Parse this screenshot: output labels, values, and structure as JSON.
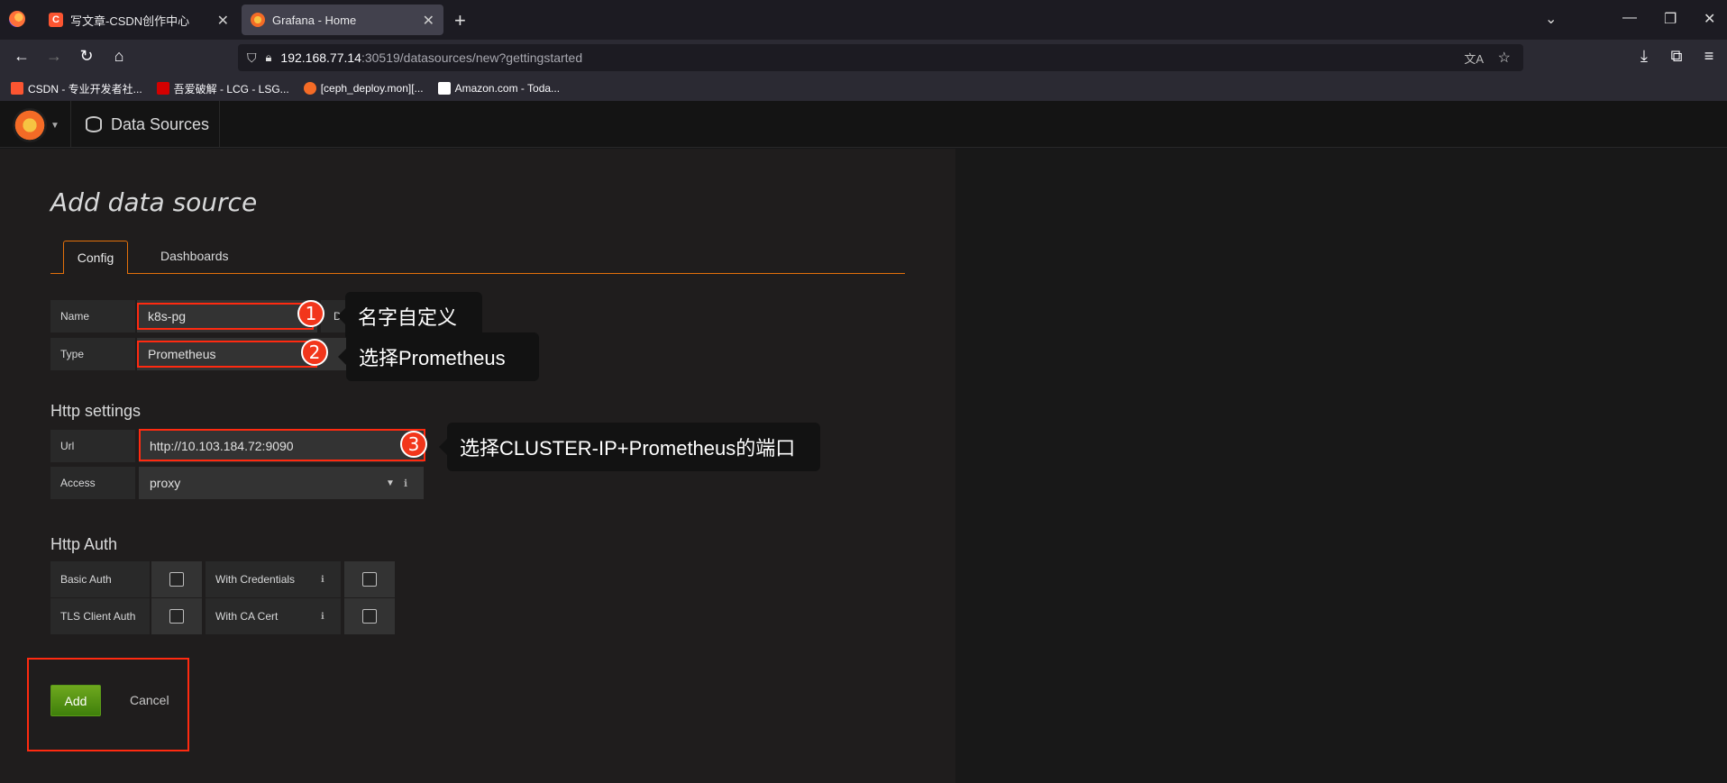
{
  "browser": {
    "tabs": [
      {
        "title": "写文章-CSDN创作中心",
        "favicon": "C"
      },
      {
        "title": "Grafana - Home",
        "favicon": "grafana-icon"
      }
    ],
    "url_host": "192.168.77.14",
    "url_path": ":30519/datasources/new?gettingstarted",
    "bookmarks": [
      {
        "label": "CSDN - 专业开发者社...",
        "color": "#fc5531"
      },
      {
        "label": "吾爱破解 - LCG - LSG...",
        "color": "#d40000"
      },
      {
        "label": "[ceph_deploy.mon][...",
        "color": "#f46b26"
      },
      {
        "label": "Amazon.com - Toda...",
        "color": "#ffffff"
      }
    ]
  },
  "grafana": {
    "breadcrumb": "Data Sources",
    "page_title": "Add data source",
    "tabs": {
      "config": "Config",
      "dashboards": "Dashboards"
    },
    "form": {
      "name_label": "Name",
      "name_value": "k8s-pg",
      "default_label": "Default",
      "type_label": "Type",
      "type_value": "Prometheus",
      "http_section": "Http settings",
      "url_label": "Url",
      "url_value": "http://10.103.184.72:9090",
      "access_label": "Access",
      "access_value": "proxy",
      "auth_section": "Http Auth",
      "basic_auth_label": "Basic Auth",
      "with_credentials_label": "With Credentials",
      "tls_label": "TLS Client Auth",
      "ca_cert_label": "With CA Cert"
    },
    "buttons": {
      "add": "Add",
      "cancel": "Cancel"
    }
  },
  "annotations": [
    {
      "number": "1",
      "text": "名字自定义"
    },
    {
      "number": "2",
      "text": "选择Prometheus"
    },
    {
      "number": "3",
      "text": "选择CLUSTER-IP+Prometheus的端口"
    }
  ],
  "colors": {
    "accent": "#e3700b",
    "annotation_red": "#ff2a10",
    "add_button": "#5a9a18"
  }
}
